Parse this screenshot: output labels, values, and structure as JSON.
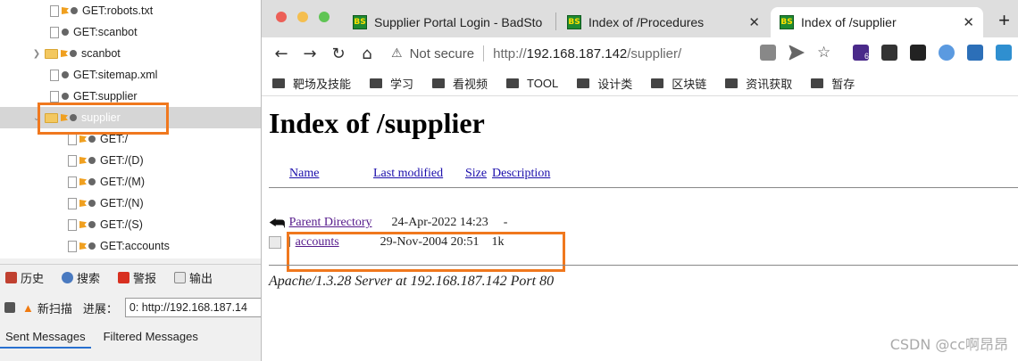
{
  "zap": {
    "tree": [
      {
        "label": "GET:robots.txt",
        "type": "file"
      },
      {
        "label": "GET:scanbot",
        "type": "file"
      },
      {
        "label": "scanbot",
        "type": "folder"
      },
      {
        "label": "GET:sitemap.xml",
        "type": "file"
      },
      {
        "label": "GET:supplier",
        "type": "file"
      },
      {
        "label": "supplier",
        "type": "folder",
        "selected": true
      },
      {
        "label": "GET:/",
        "type": "child"
      },
      {
        "label": "GET:/(D)",
        "type": "child"
      },
      {
        "label": "GET:/(M)",
        "type": "child"
      },
      {
        "label": "GET:/(N)",
        "type": "child"
      },
      {
        "label": "GET:/(S)",
        "type": "child"
      },
      {
        "label": "GET:accounts",
        "type": "child"
      }
    ],
    "tabs": [
      "历史",
      "搜索",
      "警报",
      "输出"
    ],
    "new_scan": "新扫描",
    "progress_label": "进展：",
    "progress_value": "0: http://192.168.187.14",
    "msg_tabs": [
      "Sent Messages",
      "Filtered Messages"
    ]
  },
  "browser": {
    "tabs": [
      {
        "title": "Supplier Portal Login - BadSto",
        "active": false
      },
      {
        "title": "Index of /Procedures",
        "active": false
      },
      {
        "title": "Index of /supplier",
        "active": true
      }
    ],
    "favicon_text": "BS",
    "url": {
      "security": "Not secure",
      "host": "192.168.187.142",
      "path": "/supplier/",
      "prefix": "http://"
    },
    "extension_badge": "6",
    "bookmarks": [
      "靶场及技能",
      "学习",
      "看视频",
      "TOOL",
      "设计类",
      "区块链",
      "资讯获取",
      "暂存"
    ]
  },
  "page": {
    "title": "Index of /supplier",
    "columns": [
      "Name",
      "Last modified",
      "Size",
      "Description"
    ],
    "rows": [
      {
        "name": "Parent Directory",
        "modified": "24-Apr-2022 14:23",
        "size": "-"
      },
      {
        "prefix": "]",
        "name": "accounts",
        "modified": "29-Nov-2004 20:51",
        "size": "1k"
      }
    ],
    "address": "Apache/1.3.28 Server at 192.168.187.142 Port 80"
  },
  "watermark": "CSDN @cc啊昂昂"
}
